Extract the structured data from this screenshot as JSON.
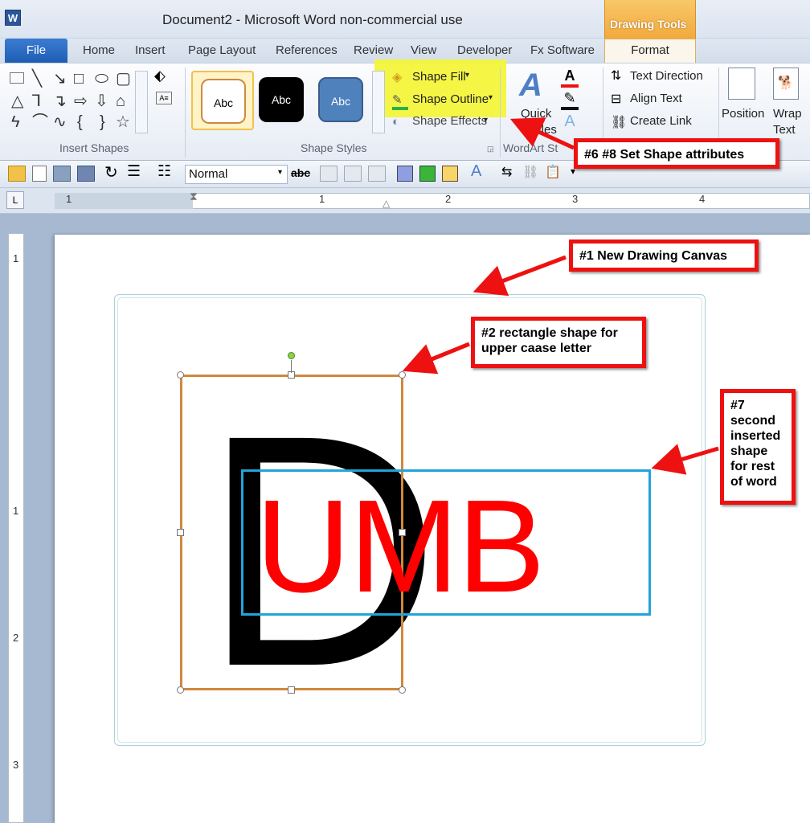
{
  "window": {
    "title": "Document2  -  Microsoft Word non-commercial use",
    "app_icon": "W",
    "contextual_tab_group": "Drawing Tools"
  },
  "tabs": [
    "File",
    "Home",
    "Insert",
    "Page Layout",
    "References",
    "Review",
    "View",
    "Developer",
    "Fx Software",
    "Format"
  ],
  "ribbon": {
    "insert_shapes": {
      "label": "Insert Shapes"
    },
    "shape_styles": {
      "label": "Shape Styles",
      "presets": [
        "Abc",
        "Abc",
        "Abc"
      ],
      "fill": "Shape Fill",
      "outline": "Shape Outline",
      "effects": "Shape Effects"
    },
    "wordart": {
      "label": "WordArt Styles",
      "label_visible": "WordArt St",
      "quick": "Quick",
      "quick2": "Styles"
    },
    "text": {
      "direction": "Text Direction",
      "align": "Align Text",
      "link": "Create Link"
    },
    "arrange": {
      "position": "Position",
      "wrap1": "Wrap",
      "wrap2": "Text"
    }
  },
  "toolbar2": {
    "style": "Normal",
    "strike": "abc"
  },
  "ruler": {
    "tab_selector": "L",
    "numbers": [
      "1",
      "1",
      "2",
      "3",
      "4"
    ],
    "vnumbers": [
      "1",
      "1",
      "2",
      "3"
    ]
  },
  "document": {
    "letter_upper": "D",
    "letters_rest": "UMB"
  },
  "annotations": {
    "a1": "#1 New Drawing Canvas",
    "a2_line1": "#2 rectangle shape for",
    "a2_line2": "upper caase letter",
    "a6": "#6 #8 Set Shape attributes",
    "a7": [
      "#7",
      "second",
      "inserted",
      "shape",
      "for rest",
      "of word"
    ]
  },
  "colors": {
    "callout_border": "#ee1111",
    "highlight": "#f3f43a",
    "upper_rect": "#d0883e",
    "rest_rect": "#22a3dc",
    "red_letters": "#ff0000"
  }
}
